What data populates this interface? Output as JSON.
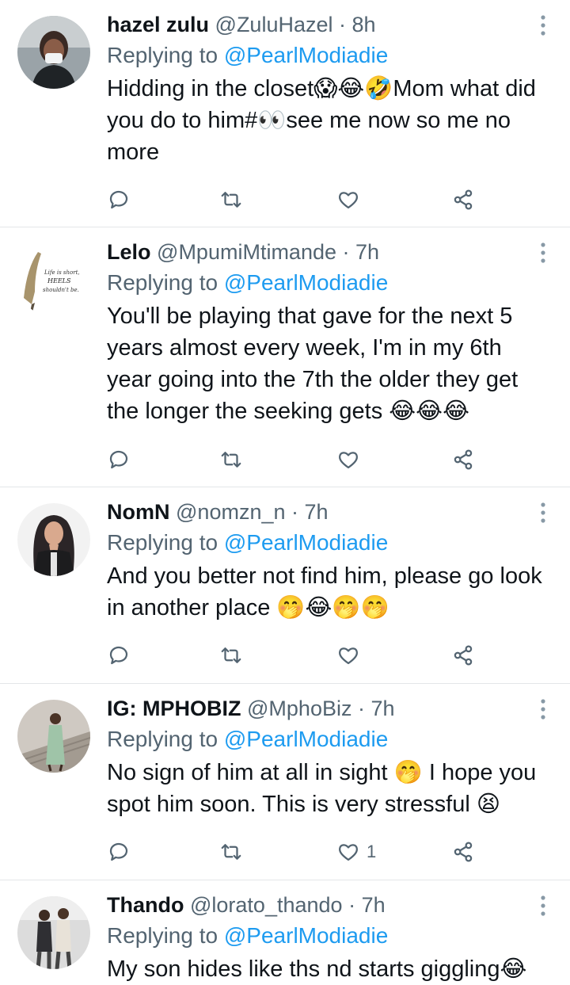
{
  "tweets": [
    {
      "name": "hazel zulu",
      "handle": "@ZuluHazel",
      "sep": "·",
      "time": "8h",
      "replying_prefix": "Replying to",
      "replying_to": "@PearlModiadie",
      "text": "Hidding in the closet😱😂🤣Mom what did you do to him#👀see me now so me no more",
      "like_count": "",
      "avatar": "person-with-mask-avatar"
    },
    {
      "name": "Lelo",
      "handle": "@MpumiMtimande",
      "sep": "·",
      "time": "7h",
      "replying_prefix": "Replying to",
      "replying_to": "@PearlModiadie",
      "text": "You'll be playing that gave for the next 5 years almost every week, I'm in my 6th year going into the 7th the older they get the longer the seeking gets 😂😂😂",
      "like_count": "",
      "avatar": "high-heel-quote-avatar",
      "avatar_text": [
        "Life is short,",
        "HEELS",
        "shouldn't be."
      ]
    },
    {
      "name": "NomN",
      "handle": "@nomzn_n",
      "sep": "·",
      "time": "7h",
      "replying_prefix": "Replying to",
      "replying_to": "@PearlModiadie",
      "text": "And you better not find him, please go look in another place 🤭😂🤭🤭",
      "like_count": "",
      "avatar": "illustrated-woman-avatar"
    },
    {
      "name": "IG: MPHOBIZ",
      "handle": "@MphoBiz",
      "sep": "·",
      "time": "7h",
      "replying_prefix": "Replying to",
      "replying_to": "@PearlModiadie",
      "text": "No sign of him at all in sight 🤭 I hope you spot him soon. This is very stressful 😫",
      "like_count": "1",
      "avatar": "woman-on-stairs-avatar"
    },
    {
      "name": "Thando",
      "handle": "@lorato_thando",
      "sep": "·",
      "time": "7h",
      "replying_prefix": "Replying to",
      "replying_to": "@PearlModiadie",
      "text": "My son hides like ths nd starts giggling😂",
      "like_count": "",
      "avatar": "couple-walking-avatar"
    }
  ],
  "colors": {
    "mention": "#1d9bf0",
    "secondary_text": "#536471",
    "divider": "#e3e6e8"
  },
  "icons": [
    "reply-icon",
    "retweet-icon",
    "like-icon",
    "share-icon",
    "more-options-icon"
  ]
}
